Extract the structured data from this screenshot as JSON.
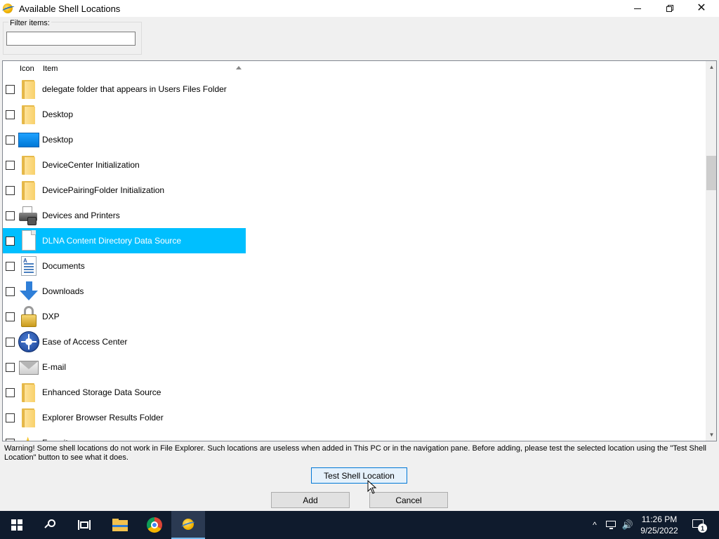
{
  "window": {
    "title": "Available Shell Locations",
    "controls": {
      "minimize": "minimize-icon",
      "restore": "restore-icon",
      "close": "close-icon"
    }
  },
  "filter": {
    "label": "Filter items:",
    "value": "",
    "placeholder": ""
  },
  "list": {
    "columns": {
      "icon": "Icon",
      "item": "Item"
    },
    "sort_indicator": "sort-ascending-icon",
    "selected_color": "#00bfff",
    "rows": [
      {
        "label": "delegate folder that appears in Users Files Folder",
        "icon": "folder-icon",
        "checked": false,
        "selected": false
      },
      {
        "label": "Desktop",
        "icon": "folder-icon",
        "checked": false,
        "selected": false
      },
      {
        "label": "Desktop",
        "icon": "desktop-icon",
        "checked": false,
        "selected": false
      },
      {
        "label": "DeviceCenter Initialization",
        "icon": "folder-icon",
        "checked": false,
        "selected": false
      },
      {
        "label": "DevicePairingFolder Initialization",
        "icon": "folder-icon",
        "checked": false,
        "selected": false
      },
      {
        "label": "Devices and Printers",
        "icon": "printer-icon",
        "checked": false,
        "selected": false
      },
      {
        "label": "DLNA Content Directory Data Source",
        "icon": "document-icon",
        "checked": false,
        "selected": true
      },
      {
        "label": "Documents",
        "icon": "documents-icon",
        "checked": false,
        "selected": false
      },
      {
        "label": "Downloads",
        "icon": "download-arrow-icon",
        "checked": false,
        "selected": false
      },
      {
        "label": "DXP",
        "icon": "lock-icon",
        "checked": false,
        "selected": false
      },
      {
        "label": "Ease of Access Center",
        "icon": "ease-of-access-icon",
        "checked": false,
        "selected": false
      },
      {
        "label": "E-mail",
        "icon": "mail-icon",
        "checked": false,
        "selected": false
      },
      {
        "label": "Enhanced Storage Data Source",
        "icon": "folder-icon",
        "checked": false,
        "selected": false
      },
      {
        "label": "Explorer Browser Results Folder",
        "icon": "folder-icon",
        "checked": false,
        "selected": false
      },
      {
        "label": "Favorites",
        "icon": "star-icon",
        "checked": false,
        "selected": false
      }
    ]
  },
  "warning": "Warning! Some shell locations do not work in File Explorer. Such locations are useless when added in This PC or in the navigation pane. Before adding, please test the selected location using the \"Test Shell Location\" button to see what it does.",
  "buttons": {
    "test": "Test Shell Location",
    "add": "Add",
    "cancel": "Cancel"
  },
  "taskbar": {
    "apps": [
      "start-icon",
      "search-icon",
      "task-view-icon",
      "file-explorer-icon",
      "chrome-icon",
      "winaero-tweaker-icon"
    ],
    "active_app": "winaero-tweaker-icon",
    "time": "11:26 PM",
    "date": "9/25/2022",
    "notification_count": "1",
    "tray_chevron": "^",
    "volume_glyph": "🔊"
  }
}
